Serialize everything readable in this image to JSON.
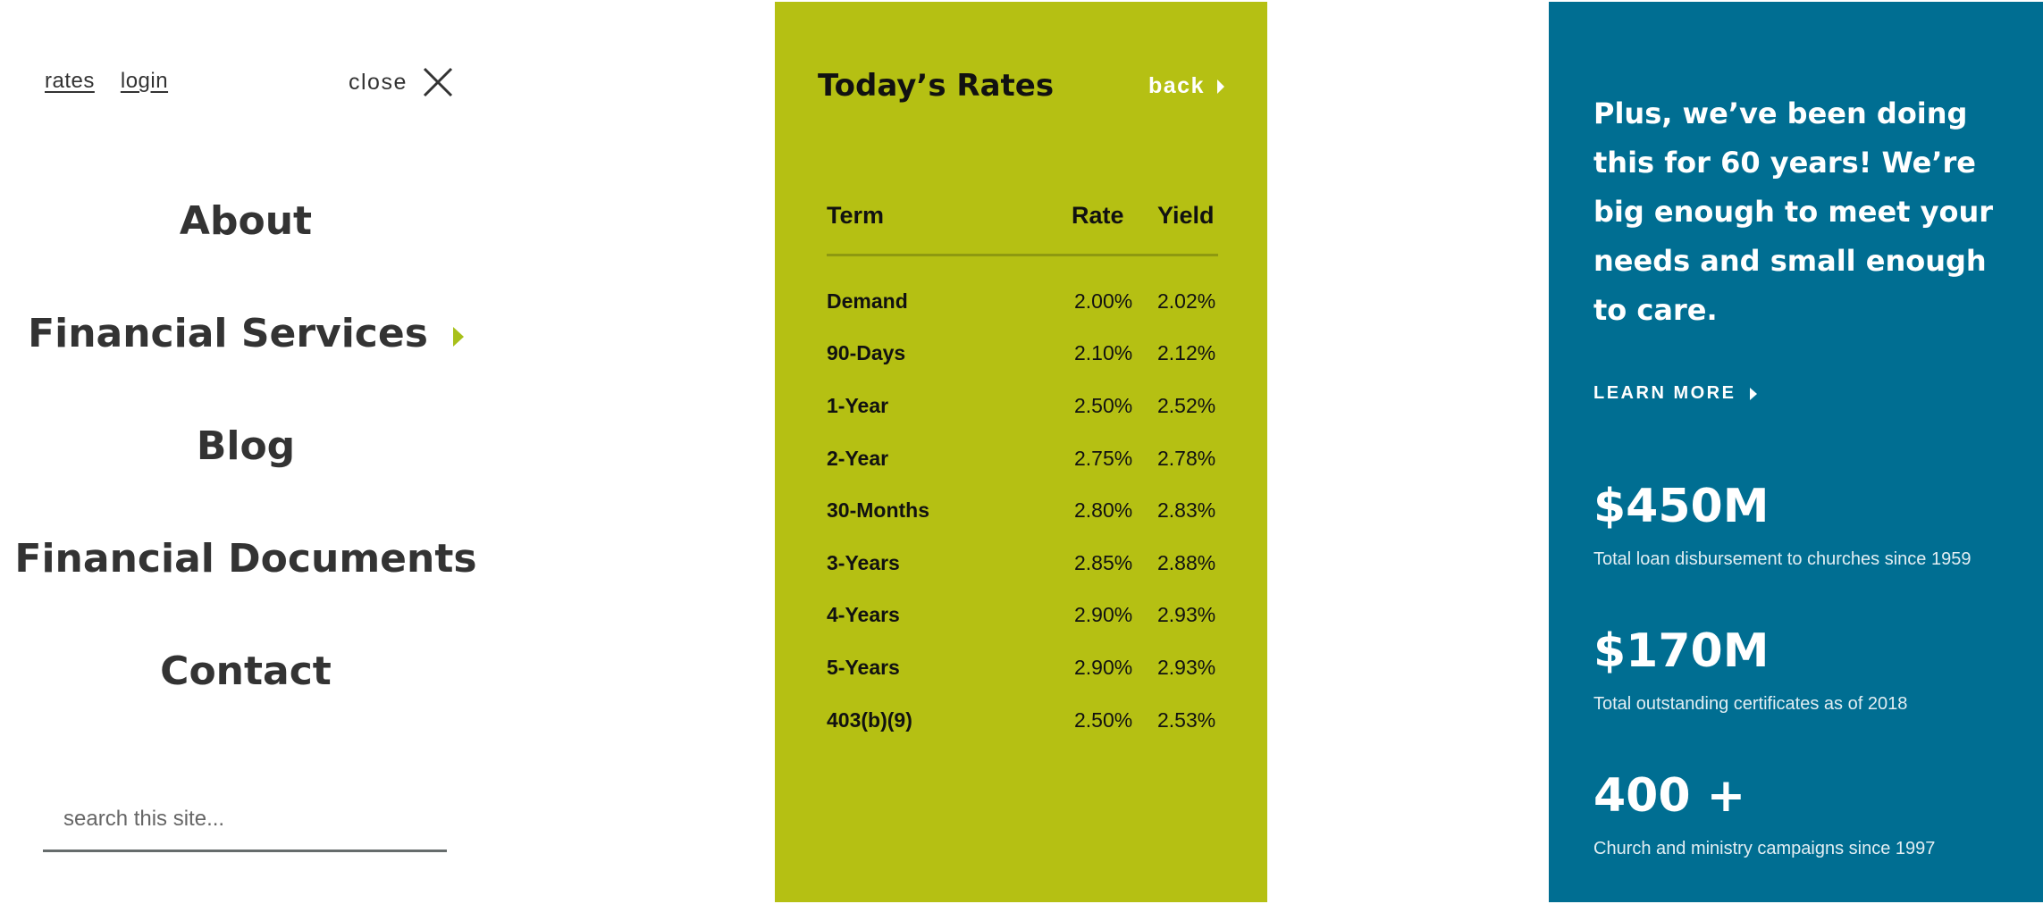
{
  "menu": {
    "top_links": [
      "rates",
      "login"
    ],
    "close_label": "close",
    "nav_items": [
      {
        "label": "About",
        "has_submenu": false
      },
      {
        "label": "Financial Services",
        "has_submenu": true
      },
      {
        "label": "Blog",
        "has_submenu": false
      },
      {
        "label": "Financial Documents",
        "has_submenu": false
      },
      {
        "label": "Contact",
        "has_submenu": false
      }
    ],
    "search": {
      "value": "",
      "placeholder": "search this site..."
    },
    "icons": {
      "close": "close-icon",
      "submenu": "chevron-right-icon"
    },
    "colors": {
      "text": "#333333",
      "accent": "#a8c01a",
      "search_underline": "#666c6c"
    }
  },
  "rates": {
    "title": "Today’s Rates",
    "back_label": "back",
    "columns": [
      "Term",
      "Rate",
      "Yield"
    ],
    "rows": [
      [
        "Demand",
        "2.00%",
        "2.02%"
      ],
      [
        "90-Days",
        "2.10%",
        "2.12%"
      ],
      [
        "1-Year",
        "2.50%",
        "2.52%"
      ],
      [
        "2-Year",
        "2.75%",
        "2.78%"
      ],
      [
        "30-Months",
        "2.80%",
        "2.83%"
      ],
      [
        "3-Years",
        "2.85%",
        "2.88%"
      ],
      [
        "4-Years",
        "2.90%",
        "2.93%"
      ],
      [
        "5-Years",
        "2.90%",
        "2.93%"
      ],
      [
        "403(b)(9)",
        "2.50%",
        "2.53%"
      ]
    ],
    "colors": {
      "background": "#b5c013",
      "text": "#111111",
      "back": "#ffffff"
    }
  },
  "promo": {
    "text": "Plus, we’ve been doing this for 60 years! We’re big enough to meet your needs and small enough to care.",
    "learn_more_label": "LEARN MORE",
    "stats": [
      {
        "value": "$450M",
        "description": "Total loan disbursement to churches since 1959"
      },
      {
        "value": "$170M",
        "description": "Total outstanding certificates as of 2018"
      },
      {
        "value": "400 +",
        "description": "Church and ministry campaigns since 1997"
      }
    ],
    "colors": {
      "background": "#006e92",
      "text": "#ffffff"
    }
  }
}
